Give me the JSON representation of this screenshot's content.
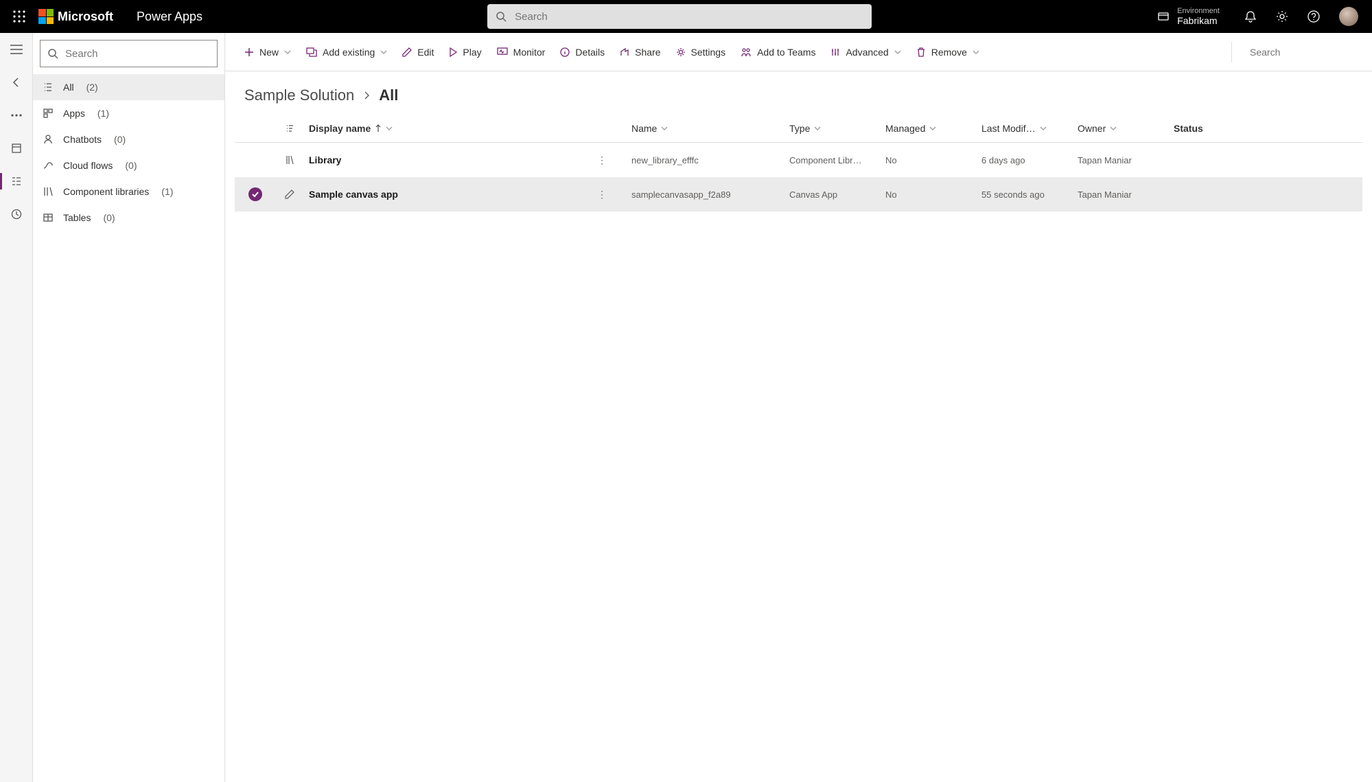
{
  "header": {
    "microsoft": "Microsoft",
    "appname": "Power Apps",
    "search_placeholder": "Search",
    "env_label": "Environment",
    "env_name": "Fabrikam"
  },
  "sidebar": {
    "search_placeholder": "Search",
    "items": [
      {
        "label": "All",
        "count": "(2)"
      },
      {
        "label": "Apps",
        "count": "(1)"
      },
      {
        "label": "Chatbots",
        "count": "(0)"
      },
      {
        "label": "Cloud flows",
        "count": "(0)"
      },
      {
        "label": "Component libraries",
        "count": "(1)"
      },
      {
        "label": "Tables",
        "count": "(0)"
      }
    ]
  },
  "commands": {
    "new": "New",
    "addexisting": "Add existing",
    "edit": "Edit",
    "play": "Play",
    "monitor": "Monitor",
    "details": "Details",
    "share": "Share",
    "settings": "Settings",
    "addteams": "Add to Teams",
    "advanced": "Advanced",
    "remove": "Remove",
    "search_placeholder": "Search"
  },
  "breadcrumb": {
    "parent": "Sample Solution",
    "current": "All"
  },
  "table": {
    "headers": {
      "display_name": "Display name",
      "name": "Name",
      "type": "Type",
      "managed": "Managed",
      "modified": "Last Modif…",
      "owner": "Owner",
      "status": "Status"
    },
    "rows": [
      {
        "display_name": "Library",
        "name": "new_library_efffc",
        "type": "Component Libr…",
        "managed": "No",
        "modified": "6 days ago",
        "owner": "Tapan Maniar",
        "status": "",
        "selected": false,
        "icon": "library"
      },
      {
        "display_name": "Sample canvas app",
        "name": "samplecanvasapp_f2a89",
        "type": "Canvas App",
        "managed": "No",
        "modified": "55 seconds ago",
        "owner": "Tapan Maniar",
        "status": "",
        "selected": true,
        "icon": "edit"
      }
    ]
  }
}
